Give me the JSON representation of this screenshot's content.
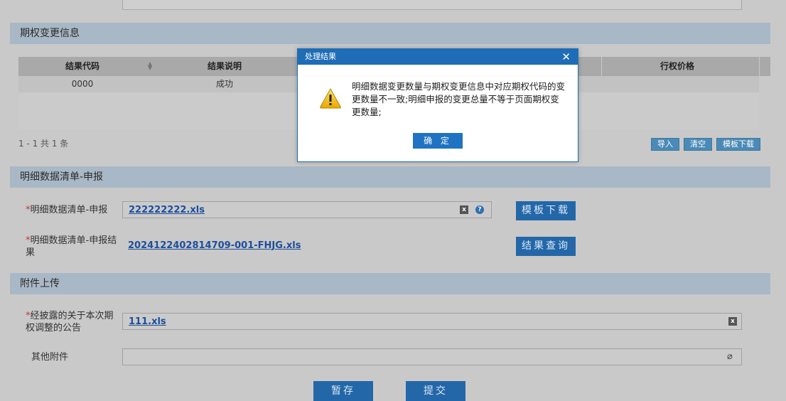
{
  "section_option_change": {
    "title": "期权变更信息",
    "grid": {
      "columns": [
        "结果代码",
        "结果说明",
        "行权价格"
      ],
      "rows": [
        {
          "code": "0000",
          "desc": "成功"
        }
      ],
      "pager": "1 - 1   共 1 条",
      "buttons": {
        "import": "导入",
        "clear": "清空",
        "template": "模板下载"
      }
    }
  },
  "section_detail": {
    "title": "明细数据清单-申报",
    "fields": {
      "declare_label": "明细数据清单-申报",
      "declare_file": "222222222.xls",
      "template_button": "模板下载",
      "result_label": "明细数据清单-申报结果",
      "result_file": "20241224028147​09-001-FHJG.xls",
      "query_button": "结果查询"
    }
  },
  "section_attach": {
    "title": "附件上传",
    "fields": {
      "notice_label": "经披露的关于本次期权调整的公告",
      "notice_file": "111.xls",
      "other_label": "其他附件"
    }
  },
  "actions": {
    "save": "暂存",
    "submit": "提交"
  },
  "dialog": {
    "title": "处理结果",
    "close": "✕",
    "message": "明细数据变更数量与期权变更信息中对应期权代码的变更数量不一致;明细申报的变更总量不等于页面期权变更数量;",
    "ok": "确 定"
  },
  "colors": {
    "header_bar": "#a9b8c6",
    "primary_button": "#2467a8",
    "dialog_title": "#1f6db6"
  },
  "icons": [
    "excel-icon",
    "help-icon",
    "attachment-icon",
    "warning-icon",
    "sort-icon"
  ]
}
